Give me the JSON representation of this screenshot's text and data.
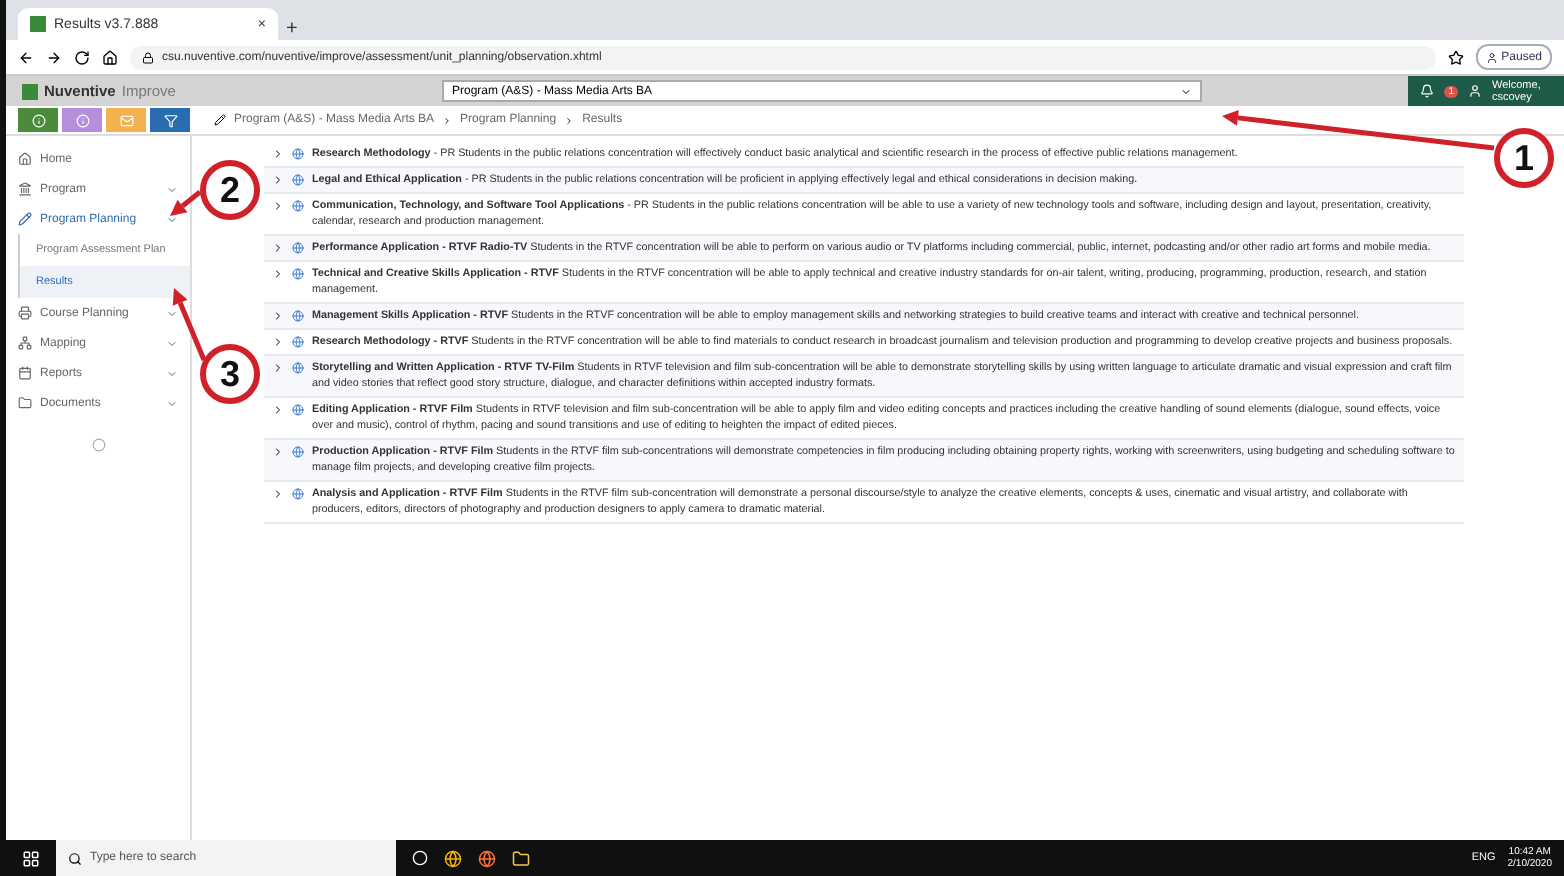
{
  "browser": {
    "tab_title": "Results v3.7.888",
    "close": "×",
    "new_tab": "+",
    "url": "csu.nuventive.com/nuventive/improve/assessment/unit_planning/observation.xhtml",
    "profile": "Paused"
  },
  "app": {
    "brand": "Nuventive",
    "product": "Improve",
    "unit_select": "Program (A&S) - Mass Media Arts BA",
    "welcome": "Welcome, cscovey",
    "alerts": "1"
  },
  "breadcrumb": [
    "Program (A&S) - Mass Media Arts BA",
    "Program Planning",
    "Results"
  ],
  "sidebar": {
    "items": [
      {
        "label": "Home",
        "selected": false,
        "expandable": false
      },
      {
        "label": "Program",
        "selected": false,
        "expandable": true
      },
      {
        "label": "Program Planning",
        "selected": true,
        "expandable": true,
        "children": [
          {
            "label": "Program Assessment Plan",
            "selected": false
          },
          {
            "label": "Results",
            "selected": true
          }
        ]
      },
      {
        "label": "Course Planning",
        "selected": false,
        "expandable": true
      },
      {
        "label": "Mapping",
        "selected": false,
        "expandable": true
      },
      {
        "label": "Reports",
        "selected": false,
        "expandable": true
      },
      {
        "label": "Documents",
        "selected": false,
        "expandable": true
      }
    ]
  },
  "rows": [
    "**Research Methodology** - PR Students in the public relations concentration will effectively conduct basic analytical and scientific research in the process of effective public relations management.",
    "**Legal and Ethical Application** - PR Students in the public relations concentration will be proficient in applying effectively legal and ethical considerations in decision making.",
    "**Communication, Technology, and Software Tool Applications** - PR Students in the public relations concentration will be able to use a variety of new technology tools and software, including design and layout, presentation, creativity, calendar, research and production management.",
    "**Performance Application - RTVF Radio-TV** Students in the RTVF concentration will be able to perform on various audio or TV platforms including commercial, public, internet, podcasting and/or other radio art forms and mobile media.",
    "**Technical and Creative Skills Application - RTVF** Students in the RTVF concentration will be able to apply technical and creative industry standards for on-air talent, writing, producing, programming, production, research, and station management.",
    "**Management Skills Application - RTVF** Students in the RTVF concentration will be able to employ management skills and networking strategies to build creative teams and interact with creative and technical personnel.",
    "**Research Methodology - RTVF** Students in the RTVF concentration will be able to find materials to conduct research in broadcast journalism and television production and programming to develop creative projects and business proposals.",
    "**Storytelling and Written Application - RTVF TV-Film** Students in RTVF television and film sub-concentration will be able to demonstrate storytelling skills by using written language to articulate dramatic and visual expression and craft film and video stories that reflect good story structure, dialogue, and character definitions within accepted industry formats.",
    "**Editing Application - RTVF Film** Students in RTVF television and film sub-concentration will be able to apply film and video editing concepts and practices including the creative handling of sound elements (dialogue, sound effects, voice over and music), control of rhythm, pacing and sound transitions and use of editing to heighten the impact of edited pieces.",
    "**Production Application - RTVF Film** Students in the RTVF film sub-concentrations will demonstrate competencies in film producing including obtaining property rights, working with screenwriters, using budgeting and scheduling software to manage film projects, and developing creative film projects.",
    "**Analysis and Application - RTVF Film** Students in the RTVF film sub-concentration will demonstrate a personal discourse/style to analyze the creative elements, concepts & uses, cinematic and visual artistry, and collaborate with producers, editors, directors of photography and production designers to apply camera to dramatic material."
  ],
  "callouts": [
    "1",
    "2",
    "3"
  ],
  "taskbar": {
    "search": "Type here to search",
    "lang": "ENG",
    "time": "10:42 AM",
    "date": "2/10/2020"
  }
}
